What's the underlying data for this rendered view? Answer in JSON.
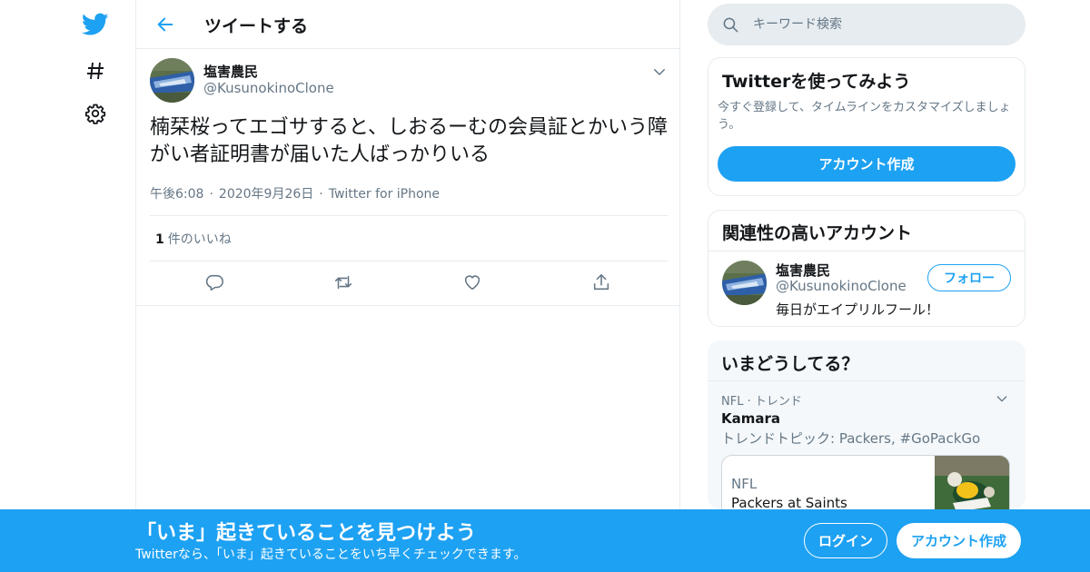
{
  "colors": {
    "accent": "#1da1f2",
    "secondary_text": "#657786",
    "border": "#e6ecf0"
  },
  "nav": {
    "icons": [
      "twitter-logo-icon",
      "hashtag-icon",
      "gear-icon"
    ]
  },
  "header": {
    "title": "ツイートする"
  },
  "tweet": {
    "author_name": "塩害農民",
    "author_handle": "@KusunokinoClone",
    "text": "楠栞桜ってエゴサすると、しおるーむの会員証とかいう障がい者証明書が届いた人ばっかりいる",
    "time": "午後6:08",
    "date": "2020年9月26日",
    "source": "Twitter for iPhone",
    "like_count": "1",
    "like_label": "件のいいね",
    "actions": [
      "reply-icon",
      "retweet-icon",
      "like-icon",
      "share-icon"
    ]
  },
  "search": {
    "placeholder": "キーワード検索"
  },
  "signup_card": {
    "title": "Twitterを使ってみよう",
    "description": "今すぐ登録して、タイムラインをカスタマイズしましょう。",
    "button": "アカウント作成"
  },
  "related": {
    "title": "関連性の高いアカウント",
    "name": "塩害農民",
    "handle": "@KusunokinoClone",
    "bio": "毎日がエイプリルフール！",
    "follow_label": "フォロー"
  },
  "trends": {
    "title": "いまどうしてる？",
    "meta": "NFL · トレンド",
    "name": "Kamara",
    "topics": "トレンドトピック: Packers, #GoPackGo",
    "news_category": "NFL",
    "news_title": "Packers at Saints"
  },
  "bottom_bar": {
    "title": "「いま」起きていることを見つけよう",
    "subtitle": "Twitterなら、「いま」起きていることをいち早くチェックできます。",
    "login": "ログイン",
    "signup": "アカウント作成"
  }
}
